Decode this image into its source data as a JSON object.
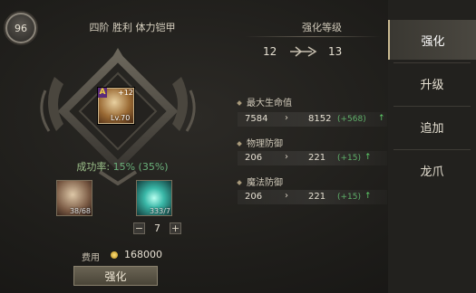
{
  "item": {
    "level": "96",
    "name": "四阶 胜利 体力铠甲",
    "grade": "A",
    "plus": "+12",
    "lv": "Lv.70"
  },
  "success_rate": {
    "label": "成功率:",
    "value": "15% (35%)"
  },
  "materials": [
    {
      "icon": "armor-shard-icon",
      "count": "38/68"
    },
    {
      "icon": "crystal-icon",
      "count": "333/7"
    }
  ],
  "quantity": "7",
  "cost": {
    "label": "费用",
    "value": "168000",
    "icon": "gold-coin-icon"
  },
  "enhance_button": "强化",
  "enhance_level": {
    "title": "强化等级",
    "from": "12",
    "to": "13"
  },
  "stats": [
    {
      "name": "最大生命值",
      "old": "7584",
      "new": "8152",
      "diff": "(+568)"
    },
    {
      "name": "物理防御",
      "old": "206",
      "new": "221",
      "diff": "(+15)"
    },
    {
      "name": "魔法防御",
      "old": "206",
      "new": "221",
      "diff": "(+15)"
    }
  ],
  "tabs": [
    "强化",
    "升级",
    "追加",
    "龙爪"
  ],
  "colors": {
    "accent_green": "#5fb06a",
    "tab_active": "#4a4740"
  }
}
